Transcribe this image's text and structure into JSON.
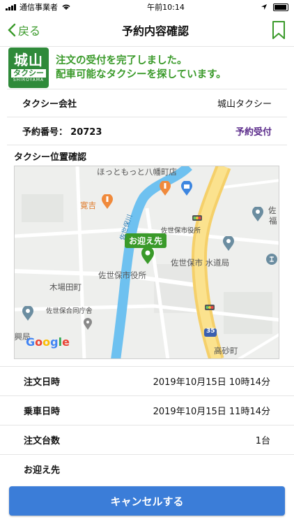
{
  "status_bar": {
    "carrier": "通信事業者",
    "time": "午前10:14"
  },
  "nav": {
    "back_label": "戻る",
    "title": "予約内容確認"
  },
  "banner": {
    "logo_main": "城山",
    "logo_sub": "タクシー",
    "logo_roman": "SHIROYAMA",
    "message_line1": "注文の受付を完了しました。",
    "message_line2": "配車可能なタクシーを探しています。"
  },
  "taxi_company": {
    "label": "タクシー会社",
    "value": "城山タクシー"
  },
  "reservation": {
    "label": "予約番号：",
    "number": "20723",
    "status": "予約受付",
    "status_color": "#5a2a8a"
  },
  "map": {
    "section_title": "タクシー位置確認",
    "pickup_tag": "お迎え先",
    "labels": {
      "hotto": "ほっともっと八幡町店",
      "kankichi": "寛吉",
      "sasebo_city_office_small": "佐世保市役所",
      "sasebo_city_office": "佐世保市役所",
      "waterworks": "佐世保市 水道局",
      "kibata": "木場田町",
      "joint_office": "佐世保合同庁舎",
      "takasago": "高砂町",
      "kogyo": "振興局",
      "river": "佐世保川",
      "sa": "佐",
      "fuku": "福",
      "route": "35"
    },
    "google": [
      "G",
      "o",
      "o",
      "g",
      "l",
      "e"
    ]
  },
  "details": [
    {
      "label": "注文日時",
      "value": "2019年10月15日 10時14分"
    },
    {
      "label": "乗車日時",
      "value": "2019年10月15日 11時14分"
    },
    {
      "label": "注文台数",
      "value": "1台"
    },
    {
      "label": "お迎え先",
      "value": ""
    }
  ],
  "cancel_button": {
    "label": "キャンセルする"
  },
  "colors": {
    "accent_green": "#3a9a2a",
    "button_blue": "#3b7dd8",
    "logo_green": "#2f8a3a"
  }
}
